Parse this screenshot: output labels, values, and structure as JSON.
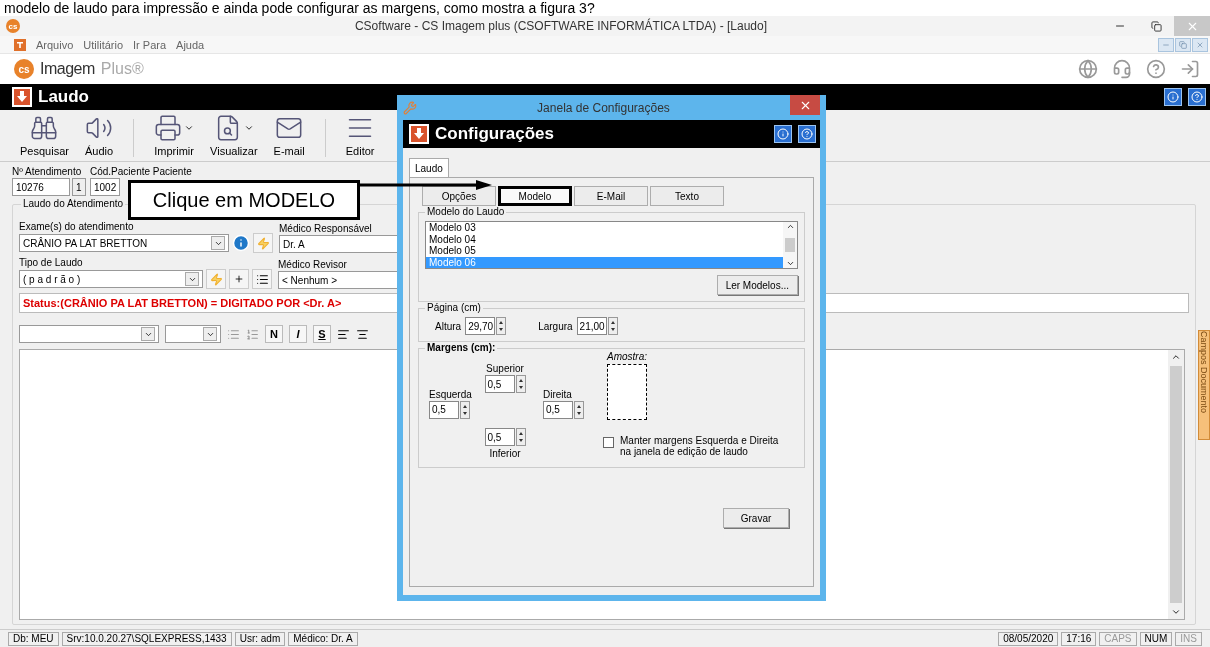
{
  "caption": "modelo de laudo para impressão e ainda pode configurar as margens, como mostra a figura 3?",
  "window": {
    "app_icon": "cs",
    "title": "CSoftware - CS Imagem plus (CSOFTWARE INFORMÁTICA LTDA) - [Laudo]",
    "menu": [
      "Arquivo",
      "Utilitário",
      "Ir Para",
      "Ajuda"
    ]
  },
  "logo": {
    "mark": "cs",
    "primary": "Imagem",
    "secondary": "Plus®"
  },
  "form_title": "Laudo",
  "toolbar": [
    {
      "kind": "search",
      "label": "Pesquisar",
      "dropdown": false
    },
    {
      "kind": "audio",
      "label": "Áudio",
      "dropdown": false
    },
    {
      "kind": "print",
      "label": "Imprimir",
      "dropdown": true
    },
    {
      "kind": "preview",
      "label": "Visualizar",
      "dropdown": true
    },
    {
      "kind": "mail",
      "label": "E-mail",
      "dropdown": false
    },
    {
      "kind": "editor",
      "label": "Editor",
      "dropdown": false
    }
  ],
  "atendimento": {
    "label": "Nº Atendimento",
    "value": "10276",
    "sequence": "1"
  },
  "paciente": {
    "label": "Cód.Paciente Paciente",
    "value": "1002"
  },
  "laudo_group": {
    "title": "Laudo do Atendimento",
    "exames": {
      "label": "Exame(s) do atendimento",
      "value": "CRÂNIO PA LAT BRETTON"
    },
    "medico_responsavel": {
      "label": "Médico Responsável",
      "value": "Dr. A"
    },
    "tipo": {
      "label": "Tipo de Laudo",
      "value": "( p a d r ã o )"
    },
    "medico_revisor": {
      "label": "Médico Revisor",
      "value": "< Nenhum >"
    },
    "status": "Status:(CRÂNIO PA LAT BRETTON) = DIGITADO POR <Dr. A>"
  },
  "format_buttons": [
    "N",
    "I",
    "S"
  ],
  "side_tab": "Campos Documento",
  "dialog": {
    "title": "Janela de Configurações",
    "header": "Configurações",
    "tabs": [
      {
        "label": "Laudo",
        "selected": true
      }
    ],
    "subtabs": [
      {
        "label": "Opções",
        "selected": false
      },
      {
        "label": "Modelo",
        "selected": true
      },
      {
        "label": "E-Mail",
        "selected": false
      },
      {
        "label": "Texto",
        "selected": false
      }
    ],
    "model_group": "Modelo do Laudo",
    "models": [
      {
        "label": "Modelo 03",
        "selected": false
      },
      {
        "label": "Modelo 04",
        "selected": false
      },
      {
        "label": "Modelo 05",
        "selected": false
      },
      {
        "label": "Modelo 06",
        "selected": true
      }
    ],
    "read_button": "Ler Modelos...",
    "page_group": "Página (cm)",
    "height": {
      "label": "Altura",
      "value": "29,70"
    },
    "width": {
      "label": "Largura",
      "value": "21,00"
    },
    "margins_group": "Margens (cm):",
    "top": {
      "label": "Superior",
      "value": "0,5"
    },
    "left": {
      "label": "Esquerda",
      "value": "0,5"
    },
    "right": {
      "label": "Direita",
      "value": "0,5"
    },
    "bottom": {
      "label": "Inferior",
      "value": "0,5"
    },
    "sample_label": "Amostra:",
    "keep_margins": {
      "label": "Manter margens Esquerda e Direita na janela de edição de laudo",
      "checked": false
    },
    "save_button": "Gravar"
  },
  "callout": {
    "text": "Clique em MODELO"
  },
  "status_left": [
    "Db: MEU",
    "Srv:10.0.20.27\\SQLEXPRESS,1433",
    "Usr: adm",
    "Médico: Dr. A"
  ],
  "status_right": [
    {
      "text": "08/05/2020",
      "on": true
    },
    {
      "text": "17:16",
      "on": true
    },
    {
      "text": "CAPS",
      "on": false
    },
    {
      "text": "NUM",
      "on": true
    },
    {
      "text": "INS",
      "on": false
    }
  ]
}
